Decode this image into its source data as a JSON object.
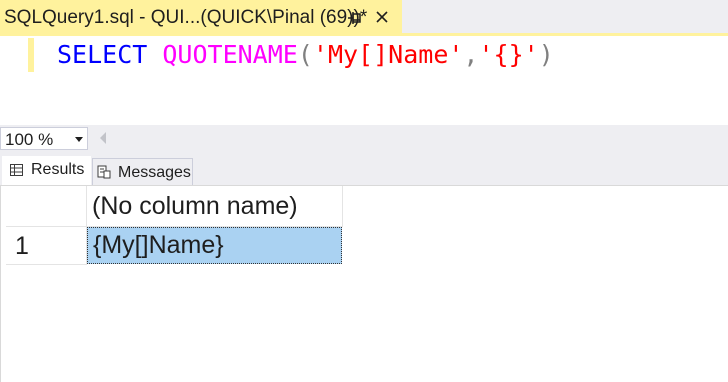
{
  "document_tab": {
    "title": "SQLQuery1.sql - QUI...(QUICK\\Pinal (69))*",
    "pin_icon": "pin-icon",
    "close_icon": "close-icon"
  },
  "editor": {
    "tokens": {
      "keyword": "SELECT",
      "function": "QUOTENAME",
      "open_paren": "(",
      "arg1": "'My[]Name'",
      "comma": ",",
      "arg2": "'{}'",
      "close_paren": ")"
    }
  },
  "zoom": {
    "value": "100 %"
  },
  "results_tabs": {
    "results_label": "Results",
    "messages_label": "Messages"
  },
  "grid": {
    "columns": [
      "(No column name)"
    ],
    "rows": [
      {
        "row_number": "1",
        "cells": [
          "{My[]Name}"
        ]
      }
    ]
  },
  "colors": {
    "tab_active": "#fff29d",
    "keyword": "#0000ff",
    "function": "#ff00ff",
    "string": "#ff0000",
    "selected_cell": "#aad2f2"
  }
}
